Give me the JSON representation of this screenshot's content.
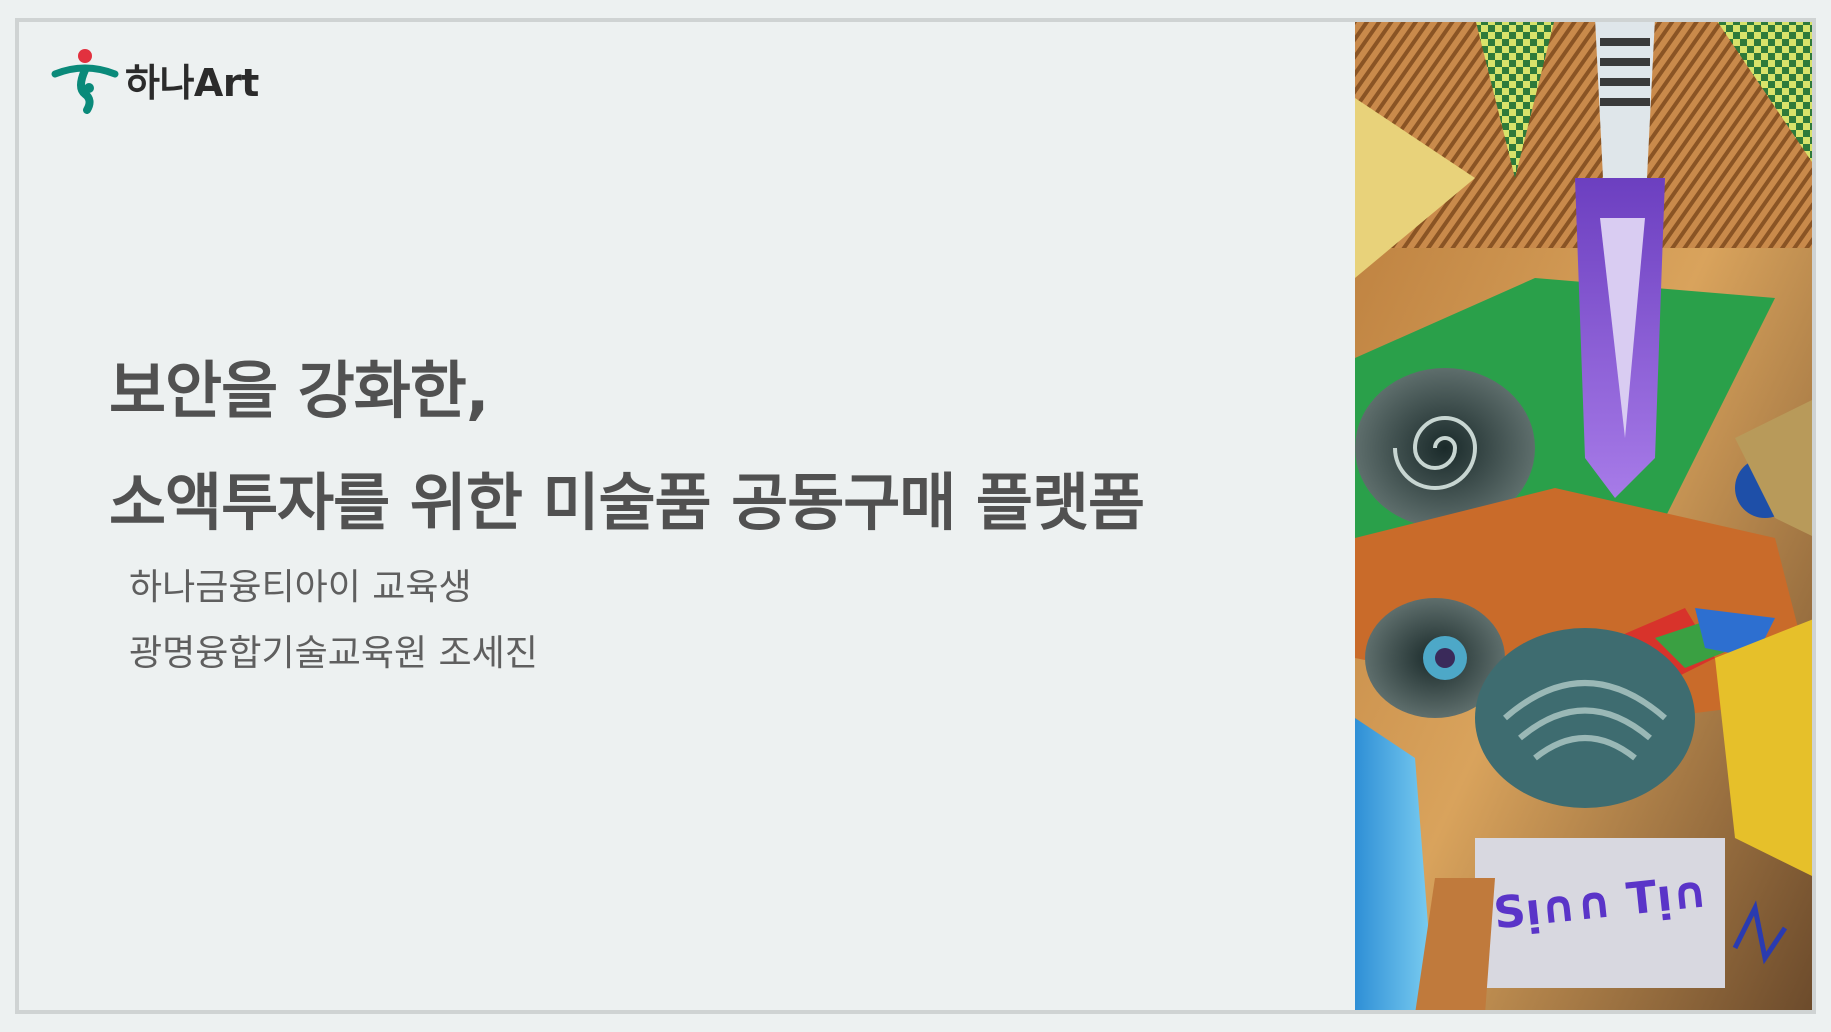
{
  "logo": {
    "text": "하나Art",
    "icon": "hana-logo-icon",
    "colors": {
      "teal": "#0a8a7a",
      "red": "#e2313f"
    }
  },
  "title": {
    "line1": "보안을 강화한,",
    "line2": "소액투자를 위한 미술품 공동구매 플랫폼"
  },
  "subtitle": {
    "line1": "하나금융티아이 교육생",
    "line2": "광명융합기술교육원 조세진"
  },
  "colors": {
    "background": "#edf1f1",
    "border": "#cfd3d3",
    "title": "#515151",
    "subtitle": "#5f5f5f"
  }
}
